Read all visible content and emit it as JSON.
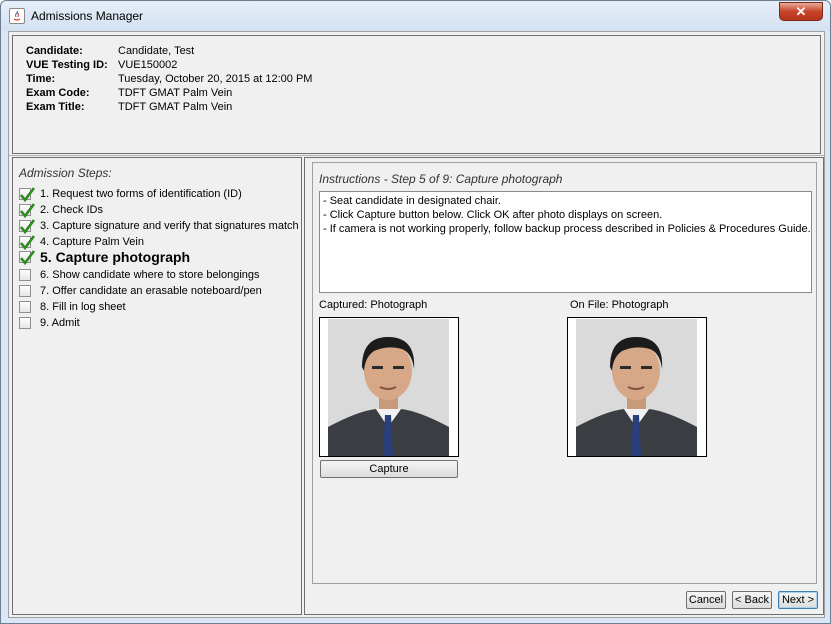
{
  "window": {
    "title": "Admissions Manager",
    "close_label": "✕"
  },
  "candidate_info": [
    {
      "label": "Candidate:",
      "value": "Candidate, Test"
    },
    {
      "label": "VUE Testing ID:",
      "value": "VUE150002"
    },
    {
      "label": "Time:",
      "value": "Tuesday, October 20, 2015 at 12:00 PM"
    },
    {
      "label": "Exam Code:",
      "value": "TDFT GMAT Palm Vein"
    },
    {
      "label": "Exam Title:",
      "value": "TDFT GMAT Palm Vein"
    }
  ],
  "steps": {
    "title": "Admission Steps:",
    "items": [
      {
        "label": "1. Request two forms of identification (ID)",
        "checked": true
      },
      {
        "label": "2. Check IDs",
        "checked": true
      },
      {
        "label": "3. Capture signature and verify that signatures match",
        "checked": true
      },
      {
        "label": "4. Capture Palm Vein",
        "checked": true
      },
      {
        "label": "5. Capture photograph",
        "checked": true,
        "current": true
      },
      {
        "label": "6. Show candidate where to store belongings",
        "checked": false
      },
      {
        "label": "7. Offer candidate an erasable noteboard/pen",
        "checked": false
      },
      {
        "label": "8. Fill in log sheet",
        "checked": false
      },
      {
        "label": "9. Admit",
        "checked": false
      }
    ]
  },
  "instructions": {
    "title": "Instructions - Step 5 of 9: Capture photograph",
    "lines": [
      "- Seat candidate in designated chair.",
      "- Click Capture button below.  Click OK after photo displays on screen.",
      "- If camera is not working properly, follow backup process described in Policies & Procedures Guide."
    ]
  },
  "photos": {
    "captured_label": "Captured: Photograph",
    "on_file_label": "On File: Photograph",
    "capture_button": "Capture"
  },
  "footer": {
    "cancel": "Cancel",
    "back": "< Back",
    "next": "Next >"
  },
  "colors": {
    "check_green": "#2e8b1f",
    "title_bar": "#dbe7f4",
    "close_red": "#c7442b"
  }
}
